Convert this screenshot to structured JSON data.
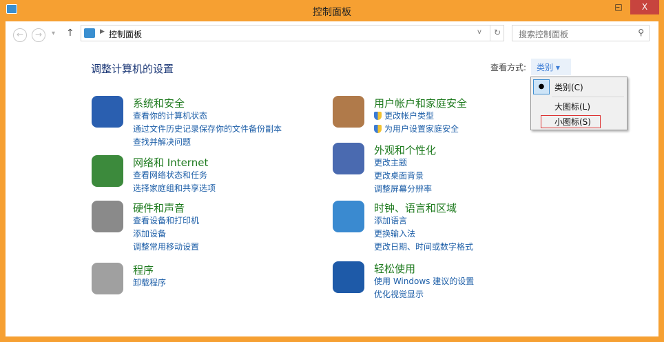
{
  "window": {
    "title": "控制面板",
    "minimize": "–",
    "maximize": "□",
    "close": "X"
  },
  "toolbar": {
    "back": "←",
    "forward": "→",
    "recent": "▾",
    "up": "↑",
    "breadcrumb": "控制面板",
    "refresh": "↻",
    "dropdown": "v",
    "search_placeholder": "搜索控制面板",
    "search_icon": "⚲"
  },
  "main": {
    "heading": "调整计算机的设置",
    "view_by_label": "查看方式:",
    "view_by_value": "类别 ▾"
  },
  "menu": {
    "items": [
      "类别(C)",
      "大图标(L)",
      "小图标(S)"
    ],
    "checked_mark": "●"
  },
  "categories": [
    {
      "title": "系统和安全",
      "links": [
        "查看你的计算机状态",
        "通过文件历史记录保存你的文件备份副本",
        "查找并解决问题"
      ],
      "color": "#2a5fb0"
    },
    {
      "title": "网络和 Internet",
      "links": [
        "查看网络状态和任务",
        "选择家庭组和共享选项"
      ],
      "color": "#3c8a3c"
    },
    {
      "title": "硬件和声音",
      "links": [
        "查看设备和打印机",
        "添加设备",
        "调整常用移动设置"
      ],
      "color": "#8a8a8a"
    },
    {
      "title": "程序",
      "links": [
        "卸载程序"
      ],
      "color": "#a0a0a0"
    },
    {
      "title": "用户帐户和家庭安全",
      "links": [
        "更改帐户类型",
        "为用户设置家庭安全"
      ],
      "color": "#b07a4a"
    },
    {
      "title": "外观和个性化",
      "links": [
        "更改主题",
        "更改桌面背景",
        "调整屏幕分辨率"
      ],
      "color": "#4a6ab0"
    },
    {
      "title": "时钟、语言和区域",
      "links": [
        "添加语言",
        "更换输入法",
        "更改日期、时间或数字格式"
      ],
      "color": "#3a8ad0"
    },
    {
      "title": "轻松使用",
      "links": [
        "使用 Windows 建议的设置",
        "优化视觉显示"
      ],
      "color": "#1e5aa8"
    }
  ]
}
